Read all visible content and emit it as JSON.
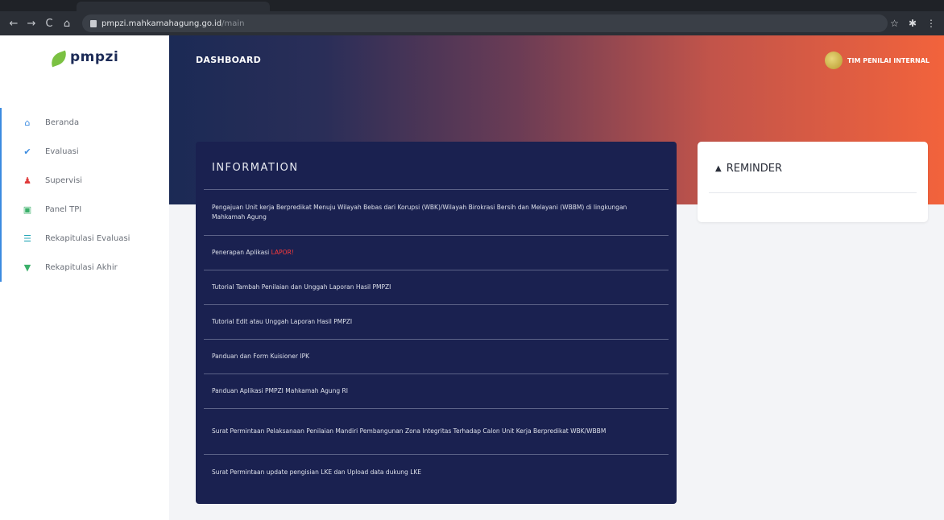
{
  "browser": {
    "url_host": "pmpzi.mahkamahagung.go.id",
    "url_path": "/main",
    "back": "←",
    "forward": "→",
    "reload": "C",
    "home": "⌂",
    "actions": [
      "☆",
      "✱",
      "⋮"
    ]
  },
  "sidebar": {
    "logo_text": "pmpzi",
    "items": [
      {
        "label": "Beranda",
        "icon": "home-icon",
        "glyph": "⌂",
        "color": "#3b8be0"
      },
      {
        "label": "Evaluasi",
        "icon": "check-icon",
        "glyph": "✔",
        "color": "#3b8be0"
      },
      {
        "label": "Supervisi",
        "icon": "user-icon",
        "glyph": "♟",
        "color": "#e03b3b"
      },
      {
        "label": "Panel TPI",
        "icon": "briefcase-icon",
        "glyph": "▣",
        "color": "#3bb06a"
      },
      {
        "label": "Rekapitulasi Evaluasi",
        "icon": "list-icon",
        "glyph": "☰",
        "color": "#2aa8b8"
      },
      {
        "label": "Rekapitulasi Akhir",
        "icon": "trophy-icon",
        "glyph": "▼",
        "color": "#3bb06a"
      }
    ]
  },
  "header": {
    "title": "DASHBOARD",
    "user_name": "TIM PENILAI INTERNAL"
  },
  "information": {
    "title": "INFORMATION",
    "items": [
      {
        "text": "Pengajuan Unit kerja Berpredikat Menuju Wilayah Bebas dari Korupsi (WBK)/Wilayah Birokrasi Bersih dan Melayani (WBBM) di lingkungan Mahkamah Agung",
        "height": 57
      },
      {
        "text": "Penerapan Aplikasi ",
        "highlight": "LAPOR!",
        "height": 43
      },
      {
        "text": "Tutorial Tambah Penilaian dan Unggah Laporan Hasil PMPZI",
        "height": 43
      },
      {
        "text": "Tutorial Edit atau Unggah Laporan Hasil PMPZI",
        "height": 43
      },
      {
        "text": "Panduan dan Form Kuisioner IPK",
        "height": 43
      },
      {
        "text": "Panduan Aplikasi PMPZI Mahkamah Agung RI",
        "height": 43
      },
      {
        "text": "Surat Permintaan Pelaksanaan Penilaian Mandiri Pembangunan Zona Integritas Terhadap Calon Unit Kerja Berpredikat WBK/WBBM",
        "height": 57
      },
      {
        "text": "Surat Permintaan update pengisian LKE dan Upload data dukung LKE",
        "height": 43
      }
    ]
  },
  "reminder": {
    "title": "REMINDER"
  }
}
